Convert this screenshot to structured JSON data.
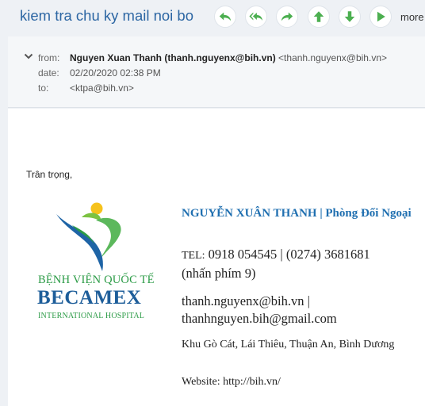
{
  "message": {
    "subject": "kiem tra chu ky mail noi bo",
    "toolbar": {
      "buttons": [
        {
          "id": "reply",
          "icon": "reply-icon"
        },
        {
          "id": "reply-all",
          "icon": "reply-all-icon"
        },
        {
          "id": "forward",
          "icon": "forward-icon"
        },
        {
          "id": "previous",
          "icon": "arrow-up-icon"
        },
        {
          "id": "next",
          "icon": "arrow-down-icon"
        },
        {
          "id": "open",
          "icon": "play-icon"
        }
      ],
      "more_label": "more"
    },
    "header": {
      "from_label": "from:",
      "from_name": "Nguyen Xuan Thanh (thanh.nguyenx@bih.vn)",
      "from_email": "<thanh.nguyenx@bih.vn>",
      "date_label": "date:",
      "date_value": "02/20/2020 02:38 PM",
      "to_label": "to:",
      "to_value": "<ktpa@bih.vn>"
    },
    "body": {
      "greeting": "Trân trọng,",
      "logo": {
        "line1": "BỆNH VIỆN QUỐC TẾ",
        "line2": "BECAMEX",
        "line3": "INTERNATIONAL HOSPITAL"
      },
      "signature": {
        "name": "NGUYỄN XUÂN THANH | Phòng Đối Ngoại",
        "tel_label": "TEL:",
        "tel_value": "0918 054545 | (0274) 3681681 (nhấn phím 9)",
        "emails": "thanh.nguyenx@bih.vn | thanhnguyen.bih@gmail.com",
        "address": "Khu Gò Cát, Lái Thiêu, Thuận An, Bình Dương",
        "website": "Website: http://bih.vn/"
      }
    }
  },
  "colors": {
    "accent": "#4caf50",
    "subject": "#2c66a3",
    "signature_name": "#1f6fb0",
    "logo_green": "#2b9b46",
    "logo_blue": "#1e5e9a"
  }
}
